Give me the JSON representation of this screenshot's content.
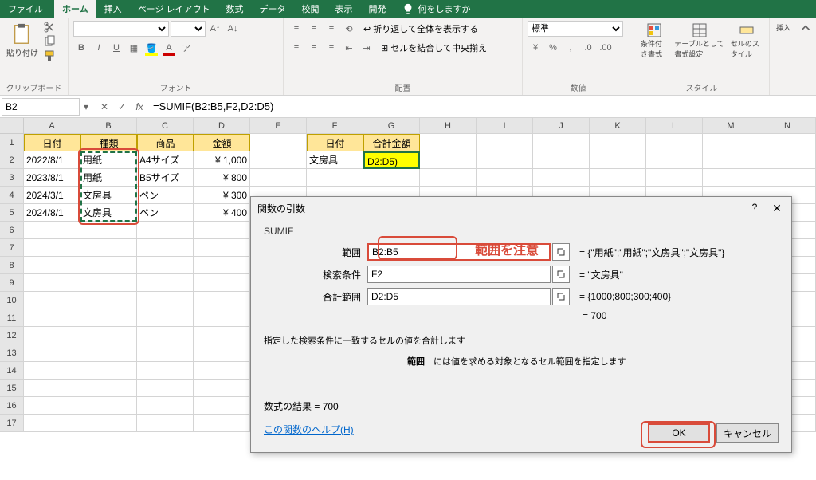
{
  "titlebar": {
    "tabs": [
      "ファイル",
      "ホーム",
      "挿入",
      "ページ レイアウト",
      "数式",
      "データ",
      "校閲",
      "表示",
      "開発"
    ],
    "active_index": 1,
    "tellme": "何をしますか"
  },
  "ribbon": {
    "groups": {
      "clipboard": {
        "label": "クリップボード",
        "paste": "貼り付け"
      },
      "font": {
        "label": "フォント",
        "bold": "B",
        "italic": "I",
        "underline": "U"
      },
      "alignment": {
        "label": "配置",
        "wrap": "折り返して全体を表示する",
        "merge": "セルを結合して中央揃え"
      },
      "number": {
        "label": "数値",
        "format": "標準"
      },
      "styles": {
        "label": "スタイル",
        "cond": "条件付き書式",
        "table": "テーブルとして書式設定",
        "cell": "セルのスタイル"
      },
      "editing": {
        "label": "挿入"
      }
    }
  },
  "formula_bar": {
    "name_box": "B2",
    "formula": "=SUMIF(B2:B5,F2,D2:D5)"
  },
  "grid": {
    "cols": [
      "A",
      "B",
      "C",
      "D",
      "E",
      "F",
      "G",
      "H",
      "I",
      "J",
      "K",
      "L",
      "M",
      "N"
    ],
    "rows": 17,
    "headers1": {
      "A": "日付",
      "B": "種類",
      "C": "商品",
      "D": "金額"
    },
    "data1": [
      {
        "A": "2022/8/1",
        "B": "用紙",
        "C": "A4サイズ",
        "D": "¥   1,000"
      },
      {
        "A": "2023/8/1",
        "B": "用紙",
        "C": "B5サイズ",
        "D": "¥      800"
      },
      {
        "A": "2024/3/1",
        "B": "文房具",
        "C": "ペン",
        "D": "¥      300"
      },
      {
        "A": "2024/8/1",
        "B": "文房具",
        "C": "ペン",
        "D": "¥      400"
      }
    ],
    "headers2": {
      "F": "日付",
      "G": "合計金額"
    },
    "data2": {
      "F": "文房具",
      "G": "D2:D5)"
    }
  },
  "dialog": {
    "title": "関数の引数",
    "func": "SUMIF",
    "args": [
      {
        "label": "範囲",
        "value": "B2:B5",
        "eval": "{\"用紙\";\"用紙\";\"文房具\";\"文房具\"}"
      },
      {
        "label": "検索条件",
        "value": "F2",
        "eval": "\"文房具\""
      },
      {
        "label": "合計範囲",
        "value": "D2:D5",
        "eval": "{1000;800;300;400}"
      }
    ],
    "total_eval": "700",
    "desc1": "指定した検索条件に一致するセルの値を合計します",
    "desc2_label": "範囲",
    "desc2": "には値を求める対象となるセル範囲を指定します",
    "result_label": "数式の結果 = ",
    "result": "700",
    "help": "この関数のヘルプ(H)",
    "ok": "OK",
    "cancel": "キャンセル"
  },
  "annotation": {
    "text": "範囲を注意"
  }
}
